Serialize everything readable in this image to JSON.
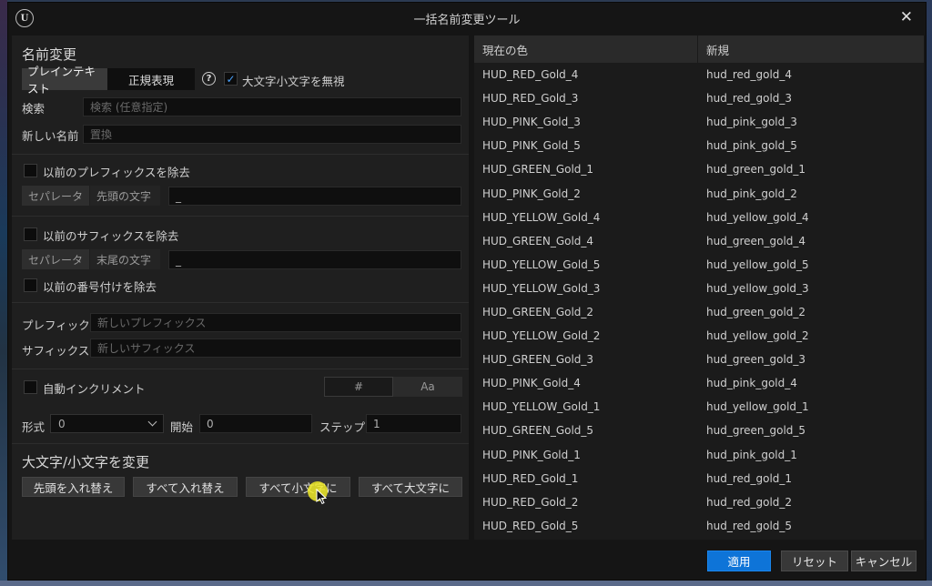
{
  "window": {
    "title": "一括名前変更ツール",
    "close_glyph": "✕",
    "logo_text": "U"
  },
  "rename": {
    "section_title": "名前変更",
    "mode_plain": "プレインテキスト",
    "mode_regex": "正規表現",
    "ignore_case_label": "大文字小文字を無視",
    "ignore_case_checked": true,
    "search_label": "検索",
    "search_placeholder": "検索 (任意指定)",
    "new_name_label": "新しい名前",
    "new_name_placeholder": "置換"
  },
  "remove_prefix": {
    "label": "以前のプレフィックスを除去",
    "separator_tag": "セパレータ",
    "leading_tag": "先頭の文字",
    "value": "_"
  },
  "remove_suffix": {
    "label": "以前のサフィックスを除去",
    "separator_tag": "セパレータ",
    "trailing_tag": "末尾の文字",
    "value": "_",
    "remove_numbering_label": "以前の番号付けを除去"
  },
  "affix": {
    "prefix_label": "プレフィック",
    "prefix_placeholder": "新しいプレフィックス",
    "suffix_label": "サフィックス",
    "suffix_placeholder": "新しいサフィックス"
  },
  "auto_increment": {
    "label": "自動インクリメント",
    "toggle_hash": "#",
    "toggle_aa": "Aa",
    "format_label": "形式",
    "format_value": "0",
    "start_label": "開始",
    "start_value": "0",
    "step_label": "ステップ",
    "step_value": "1"
  },
  "case_change": {
    "section_title": "大文字/小文字を変更",
    "btn_capitalize_first": "先頭を入れ替え",
    "btn_swap_all": "すべて入れ替え",
    "btn_all_lower": "すべて小文字に",
    "btn_all_upper": "すべて大文字に"
  },
  "table": {
    "col_current": "現在の色",
    "col_new": "新規",
    "rows": [
      {
        "current": "HUD_RED_Gold_4",
        "new": "hud_red_gold_4"
      },
      {
        "current": "HUD_RED_Gold_3",
        "new": "hud_red_gold_3"
      },
      {
        "current": "HUD_PINK_Gold_3",
        "new": "hud_pink_gold_3"
      },
      {
        "current": "HUD_PINK_Gold_5",
        "new": "hud_pink_gold_5"
      },
      {
        "current": "HUD_GREEN_Gold_1",
        "new": "hud_green_gold_1"
      },
      {
        "current": "HUD_PINK_Gold_2",
        "new": "hud_pink_gold_2"
      },
      {
        "current": "HUD_YELLOW_Gold_4",
        "new": "hud_yellow_gold_4"
      },
      {
        "current": "HUD_GREEN_Gold_4",
        "new": "hud_green_gold_4"
      },
      {
        "current": "HUD_YELLOW_Gold_5",
        "new": "hud_yellow_gold_5"
      },
      {
        "current": "HUD_YELLOW_Gold_3",
        "new": "hud_yellow_gold_3"
      },
      {
        "current": "HUD_GREEN_Gold_2",
        "new": "hud_green_gold_2"
      },
      {
        "current": "HUD_YELLOW_Gold_2",
        "new": "hud_yellow_gold_2"
      },
      {
        "current": "HUD_GREEN_Gold_3",
        "new": "hud_green_gold_3"
      },
      {
        "current": "HUD_PINK_Gold_4",
        "new": "hud_pink_gold_4"
      },
      {
        "current": "HUD_YELLOW_Gold_1",
        "new": "hud_yellow_gold_1"
      },
      {
        "current": "HUD_GREEN_Gold_5",
        "new": "hud_green_gold_5"
      },
      {
        "current": "HUD_PINK_Gold_1",
        "new": "hud_pink_gold_1"
      },
      {
        "current": "HUD_RED_Gold_1",
        "new": "hud_red_gold_1"
      },
      {
        "current": "HUD_RED_Gold_2",
        "new": "hud_red_gold_2"
      },
      {
        "current": "HUD_RED_Gold_5",
        "new": "hud_red_gold_5"
      }
    ]
  },
  "footer": {
    "apply": "適用",
    "reset": "リセット",
    "cancel": "キャンセル"
  },
  "colors": {
    "accent": "#0e74d8",
    "checkmark": "#4aa3ff",
    "cursor_highlight": "#f0eb28"
  }
}
